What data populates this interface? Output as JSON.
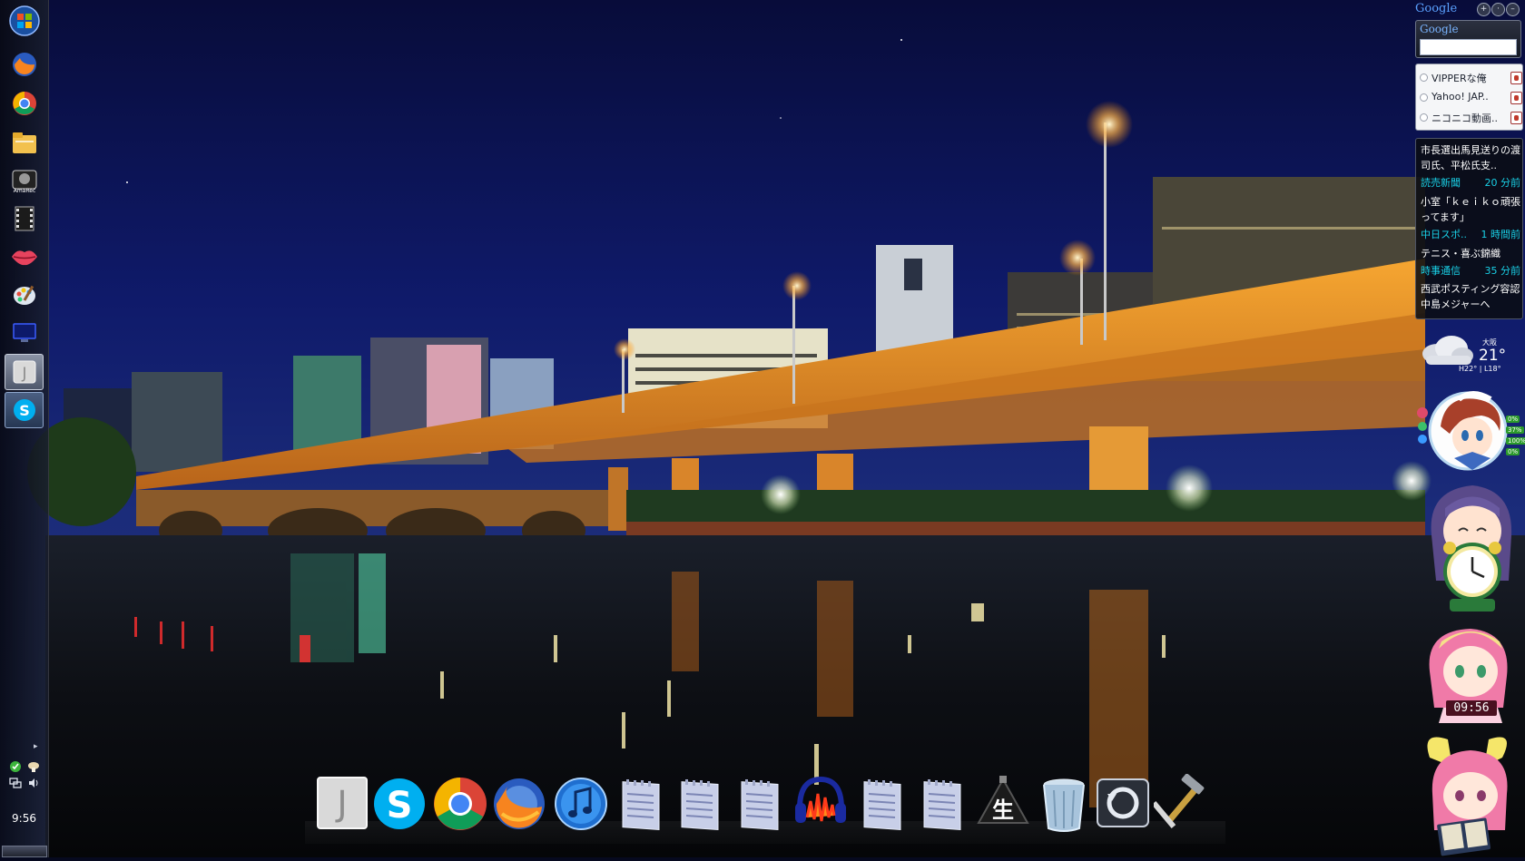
{
  "taskbar": {
    "start_icon": "windows-orb-icon",
    "items": [
      {
        "icon": "firefox-icon"
      },
      {
        "icon": "chrome-icon"
      },
      {
        "icon": "file-explorer-icon"
      },
      {
        "icon": "amarec-icon",
        "label": "AmaRec"
      },
      {
        "icon": "film-strip-icon"
      },
      {
        "icon": "lips-icon"
      },
      {
        "icon": "paint-palette-icon"
      },
      {
        "icon": "monitor-icon"
      },
      {
        "icon": "j-app-icon",
        "label": "J"
      },
      {
        "icon": "skype-icon",
        "label": "S"
      }
    ],
    "tray": {
      "icons": [
        "green-status-icon",
        "mushroom-icon",
        "network-icon",
        "volume-icon"
      ]
    },
    "clock": "9:56"
  },
  "google_gadget": {
    "header_logo": "Google",
    "box_logo": "Google",
    "search_value": "",
    "controls": [
      "+",
      "·",
      "–"
    ]
  },
  "bookmarks": {
    "items": [
      {
        "label": "VIPPERな俺"
      },
      {
        "label": "Yahoo! JAP.."
      },
      {
        "label": "ニコニコ動画.."
      }
    ]
  },
  "news": {
    "items": [
      {
        "title": "市長選出馬見送りの渡司氏、平松氏支..",
        "source": "読売新聞",
        "time": "20 分前"
      },
      {
        "title": "小室「ｋｅｉｋｏ頑張ってます」",
        "source": "中日スポ..",
        "time": "1 時間前"
      },
      {
        "title": "テニス・喜ぶ錦織",
        "source": "時事通信",
        "time": "35 分前"
      },
      {
        "title": "西武ポスティング容認 中島メジャーへ",
        "source": "",
        "time": ""
      }
    ]
  },
  "weather": {
    "city": "大阪",
    "temp": "21°",
    "hilo": "H22° | L18°",
    "condition_icon": "cloudy-icon"
  },
  "system_meter": {
    "readouts": [
      "0%",
      "37%",
      "100%",
      "0%"
    ]
  },
  "digital_clock": {
    "time": "09:56"
  },
  "dock": {
    "items": [
      {
        "name": "j-app",
        "icon": "j-app-icon",
        "label": "J"
      },
      {
        "name": "skype",
        "icon": "skype-icon",
        "label": "S"
      },
      {
        "name": "chrome",
        "icon": "chrome-icon"
      },
      {
        "name": "firefox",
        "icon": "firefox-icon"
      },
      {
        "name": "itunes",
        "icon": "itunes-icon"
      },
      {
        "name": "document-1",
        "icon": "text-document-icon"
      },
      {
        "name": "document-2",
        "icon": "text-document-icon"
      },
      {
        "name": "document-3",
        "icon": "text-document-icon"
      },
      {
        "name": "audacity",
        "icon": "audacity-icon"
      },
      {
        "name": "document-4",
        "icon": "text-document-icon"
      },
      {
        "name": "document-5",
        "icon": "text-document-icon"
      },
      {
        "name": "nico-live",
        "icon": "nico-live-icon",
        "label": "生"
      },
      {
        "name": "recycle-bin",
        "icon": "recycle-bin-icon"
      },
      {
        "name": "time-machine",
        "icon": "restore-icon"
      },
      {
        "name": "tools",
        "icon": "hammer-tools-icon"
      }
    ]
  }
}
